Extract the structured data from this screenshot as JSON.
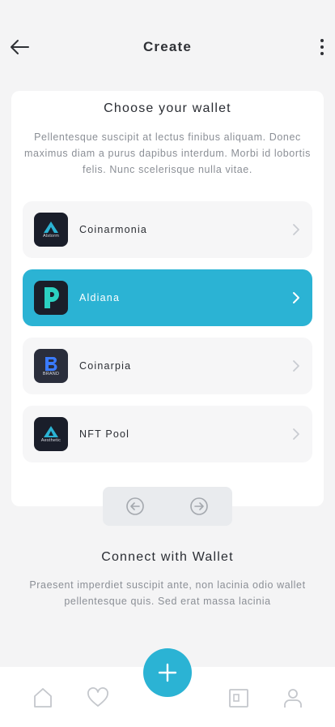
{
  "header": {
    "title": "Create"
  },
  "card": {
    "title": "Choose your wallet",
    "description": "Pellentesque suscipit at lectus finibus aliquam. Donec maximus diam a purus dapibus interdum. Morbi id lobortis felis. Nunc scelerisque nulla vitae.",
    "wallets": [
      {
        "name": "Coinarmonia",
        "logo_text": "Alstorm",
        "active": false
      },
      {
        "name": "Aldiana",
        "logo_text": "",
        "active": true
      },
      {
        "name": "Coinarpia",
        "logo_text": "BRAND",
        "active": false
      },
      {
        "name": "NFT Pool",
        "logo_text": "Aesthetic",
        "active": false
      }
    ]
  },
  "connect": {
    "title": "Connect with Wallet",
    "description": "Praesent imperdiet suscipit ante, non lacinia odio wallet pellentesque quis. Sed erat massa lacinia"
  },
  "colors": {
    "accent": "#2bb3d4",
    "background": "#f4f4f5",
    "card": "#ffffff",
    "logo_bg": "#1a1e2a"
  },
  "icons": {
    "back": "arrow-left-icon",
    "more": "kebab-menu-icon",
    "chevron": "chevron-right-icon",
    "prev": "circle-arrow-left-icon",
    "next": "circle-arrow-right-icon",
    "home": "home-icon",
    "favorites": "heart-icon",
    "add": "plus-icon",
    "wallet": "wallet-icon",
    "profile": "user-icon"
  }
}
